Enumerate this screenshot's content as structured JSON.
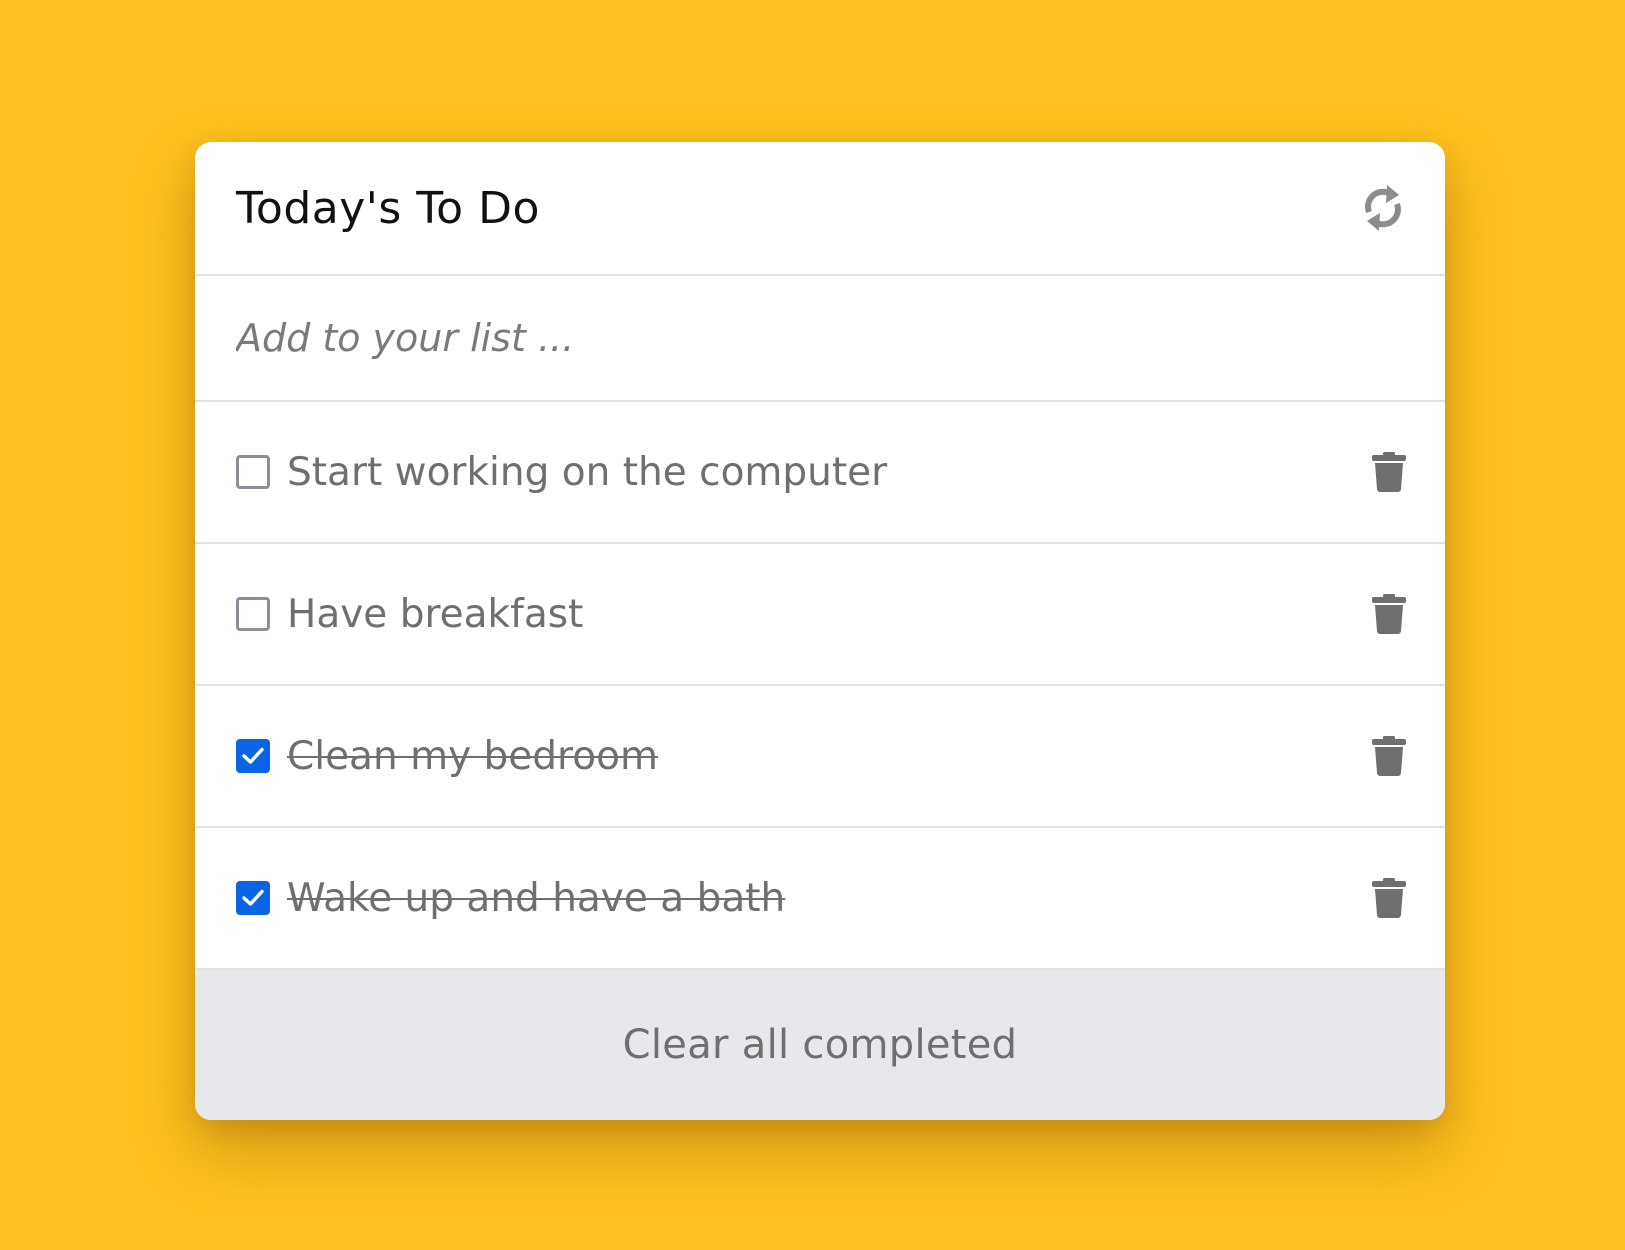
{
  "app": {
    "title": "Today's To Do",
    "refresh_icon": "refresh-icon"
  },
  "add": {
    "placeholder": "Add to your list ...",
    "value": ""
  },
  "items": [
    {
      "label": "Start working on the computer",
      "completed": false
    },
    {
      "label": "Have breakfast",
      "completed": false
    },
    {
      "label": "Clean my bedroom",
      "completed": true
    },
    {
      "label": "Wake up and have a bath",
      "completed": true
    }
  ],
  "footer": {
    "clear_label": "Clear all completed"
  },
  "colors": {
    "background": "#FEC11F",
    "accent": "#0A64E4",
    "muted_text": "#6f6f6f",
    "footer_bg": "#E8E8EC"
  }
}
